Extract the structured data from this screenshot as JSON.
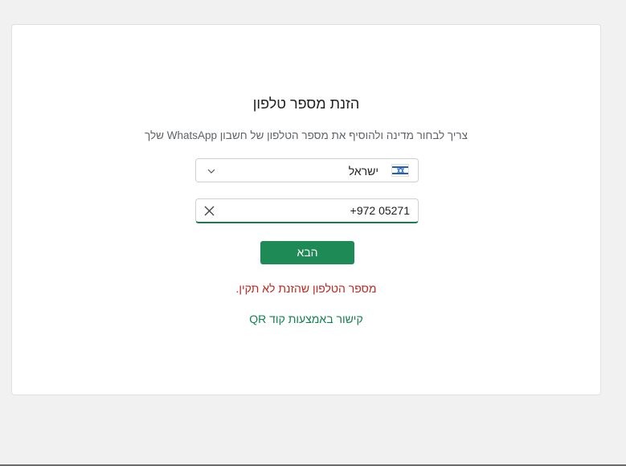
{
  "card": {
    "title": "הזנת מספר טלפון",
    "subtitle": "צריך לבחור מדינה ולהוסיף את מספר הטלפון של חשבון WhatsApp שלך"
  },
  "country_select": {
    "label": "ישראל",
    "flag_icon": "israel-flag-icon",
    "chevron_icon": "chevron-down-icon"
  },
  "phone_input": {
    "value": "+972 05271",
    "clear_icon": "close-icon"
  },
  "next_button": {
    "label": "הבא"
  },
  "error": {
    "message": "מספר הטלפון שהזנת לא תקין."
  },
  "qr_link": {
    "label": "קישור באמצעות קוד QR"
  },
  "colors": {
    "accent": "#1e8a55",
    "error": "#c0261f",
    "link": "#13804f"
  }
}
